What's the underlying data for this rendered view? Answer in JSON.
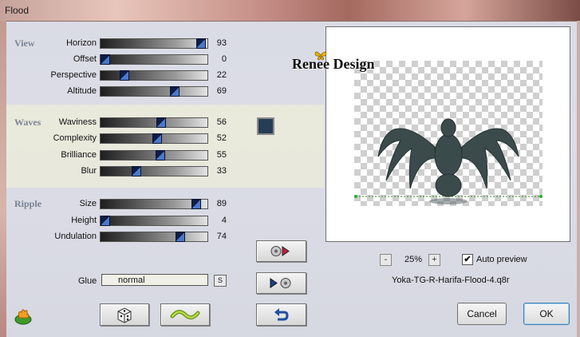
{
  "window": {
    "title": "Flood"
  },
  "sections": [
    {
      "name": "View",
      "params": [
        {
          "label": "Horizon",
          "value": 93
        },
        {
          "label": "Offset",
          "value": 0
        },
        {
          "label": "Perspective",
          "value": 22
        },
        {
          "label": "Altitude",
          "value": 69
        }
      ]
    },
    {
      "name": "Waves",
      "params": [
        {
          "label": "Waviness",
          "value": 56
        },
        {
          "label": "Complexity",
          "value": 52
        },
        {
          "label": "Brilliance",
          "value": 55
        },
        {
          "label": "Blur",
          "value": 33
        }
      ]
    },
    {
      "name": "Ripple",
      "params": [
        {
          "label": "Size",
          "value": 89
        },
        {
          "label": "Height",
          "value": 4
        },
        {
          "label": "Undulation",
          "value": 74
        }
      ]
    }
  ],
  "color_swatch": "#253e54",
  "glue": {
    "label": "Glue",
    "value": "normal",
    "drop_label": "S"
  },
  "preview": {
    "watermark": "Renee Design",
    "zoom": "25%",
    "zoom_minus": "-",
    "zoom_plus": "+",
    "auto_preview_label": "Auto preview",
    "auto_preview_checked": true,
    "check_mark": "✔",
    "filename": "Yoka-TG-R-Harifa-Flood-4.q8r"
  },
  "buttons": {
    "cancel": "Cancel",
    "ok": "OK"
  },
  "icons": [
    "flame-logo-icon",
    "dice-icon",
    "wave-icon",
    "load-preset-icon",
    "save-preset-icon",
    "undo-icon"
  ]
}
